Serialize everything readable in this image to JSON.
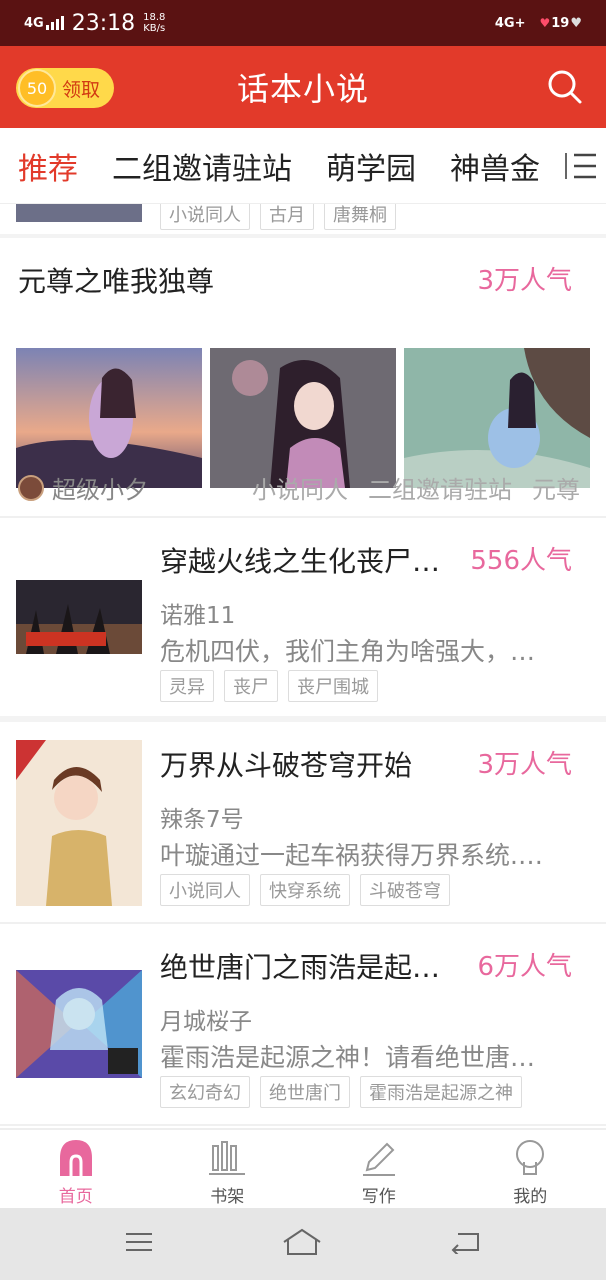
{
  "status_bar": {
    "network": "4G",
    "time": "23:18",
    "speed_value": "18.8",
    "speed_unit": "KB/s",
    "network_right": "4G+",
    "battery": "19"
  },
  "app_bar": {
    "coin_value": "50",
    "coin_label": "领取",
    "title": "话本小说",
    "search_icon": "search-icon"
  },
  "tabs": {
    "items": [
      "推荐",
      "二组邀请驻站",
      "萌学园",
      "神兽金"
    ],
    "active_index": 0,
    "menu_icon": "menu-icon"
  },
  "peek_row": {
    "tags": [
      "小说同人",
      "古月",
      "唐舞桐"
    ]
  },
  "featured": {
    "title": "元尊之唯我独尊",
    "popularity": "3万人气",
    "author": "超级小夕",
    "tags": [
      "小说同人",
      "二组邀请驻站",
      "元尊"
    ]
  },
  "books": [
    {
      "title": "穿越火线之生化丧尸…",
      "popularity": "556人气",
      "author": "诺雅11",
      "description": "危机四伏，我们主角为啥强大，…",
      "tags": [
        "灵异",
        "丧尸",
        "丧尸围城"
      ]
    },
    {
      "title": "万界从斗破苍穹开始",
      "popularity": "3万人气",
      "author": "辣条7号",
      "description": "叶璇通过一起车祸获得万界系统.…",
      "tags": [
        "小说同人",
        "快穿系统",
        "斗破苍穹"
      ]
    },
    {
      "title": "绝世唐门之雨浩是起…",
      "popularity": "6万人气",
      "author": "月城桜子",
      "description": "霍雨浩是起源之神！请看绝世唐…",
      "tags": [
        "玄幻奇幻",
        "绝世唐门",
        "霍雨浩是起源之神"
      ]
    }
  ],
  "bottom_nav": {
    "items": [
      {
        "label": "首页",
        "icon": "home-icon"
      },
      {
        "label": "书架",
        "icon": "bookshelf-icon"
      },
      {
        "label": "写作",
        "icon": "pencil-icon"
      },
      {
        "label": "我的",
        "icon": "profile-icon"
      }
    ],
    "active_index": 0
  },
  "colors": {
    "primary_red": "#e23a2a",
    "status_bar": "#5a1212",
    "popularity_pink": "#e8689d",
    "coin_yellow": "#ffd94a"
  }
}
